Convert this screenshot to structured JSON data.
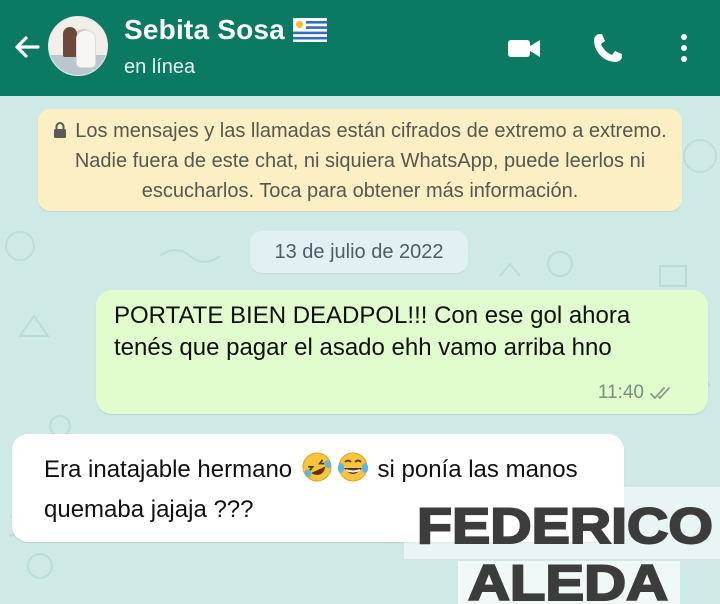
{
  "header": {
    "contact_name": "Sebita Sosa",
    "status": "en línea",
    "flag_icon": "uruguay-flag-icon",
    "icons": [
      "back-arrow-icon",
      "video-call-icon",
      "phone-icon",
      "more-vert-icon"
    ],
    "background_color": "#0b7a63"
  },
  "chat": {
    "encryption_notice": "Los mensajes y las llamadas están cifrados de extremo a extremo. Nadie fuera de este chat, ni siquiera WhatsApp, puede leerlos ni escucharlos. Toca para obtener más información.",
    "date_chip": "13 de julio de 2022",
    "messages": [
      {
        "direction": "outgoing",
        "text": "PORTATE BIEN DEADPOL!!! Con ese gol ahora tenés que pagar el asado ehh vamo arriba hno",
        "time": "11:40",
        "status_icon": "double-check-icon"
      },
      {
        "direction": "incoming",
        "text_before": "Era inatajable hermano",
        "emojis": [
          "rolling-laughing-emoji",
          "tears-of-joy-emoji"
        ],
        "text_after": "si ponía las manos quemaba jajaja ???"
      }
    ]
  },
  "watermark": {
    "line1": "FEDERICO",
    "line2": "ALEDA"
  }
}
